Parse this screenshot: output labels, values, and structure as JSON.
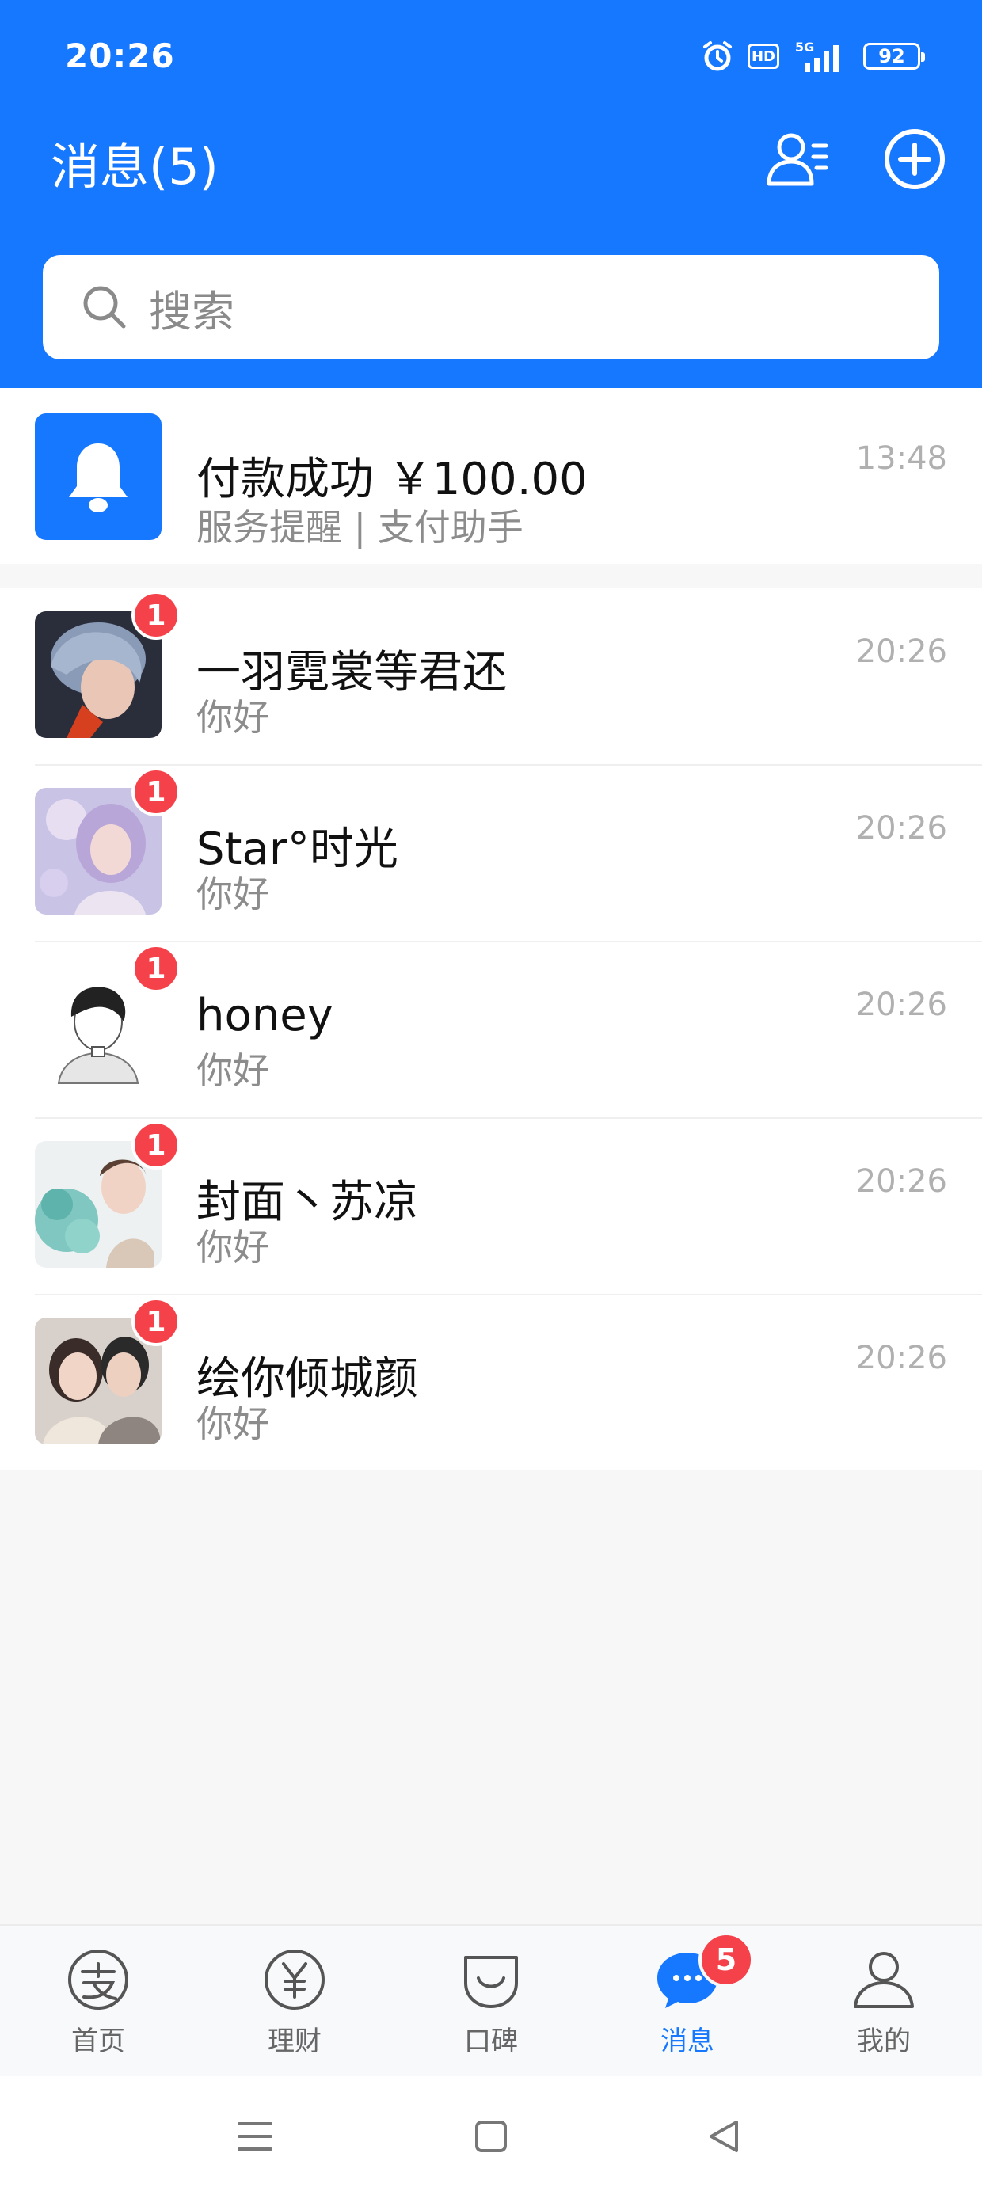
{
  "status_bar": {
    "time": "20:26",
    "hd": "HD",
    "network": "5G",
    "battery": "92"
  },
  "header": {
    "title": "消息(5)"
  },
  "search": {
    "placeholder": "搜索"
  },
  "system_messages": [
    {
      "title": "付款成功 ￥100.00",
      "subtitle": "服务提醒 | 支付助手",
      "time": "13:48"
    }
  ],
  "chats": [
    {
      "name": "一羽霓裳等君还",
      "preview": "你好",
      "time": "20:26",
      "unread": "1"
    },
    {
      "name": "Star°时光",
      "preview": "你好",
      "time": "20:26",
      "unread": "1"
    },
    {
      "name": "honey",
      "preview": "你好",
      "time": "20:26",
      "unread": "1"
    },
    {
      "name": "封面丶苏凉",
      "preview": "你好",
      "time": "20:26",
      "unread": "1"
    },
    {
      "name": "绘你倾城颜",
      "preview": "你好",
      "time": "20:26",
      "unread": "1"
    }
  ],
  "tabbar": {
    "items": [
      {
        "label": "首页",
        "icon": "alipay-icon"
      },
      {
        "label": "理财",
        "icon": "yuan-icon"
      },
      {
        "label": "口碑",
        "icon": "koubei-icon"
      },
      {
        "label": "消息",
        "icon": "message-icon",
        "badge": "5",
        "active": true
      },
      {
        "label": "我的",
        "icon": "person-icon"
      }
    ]
  },
  "colors": {
    "brand": "#1677ff",
    "badge": "#f5424a",
    "background": "#f7f7f7"
  }
}
